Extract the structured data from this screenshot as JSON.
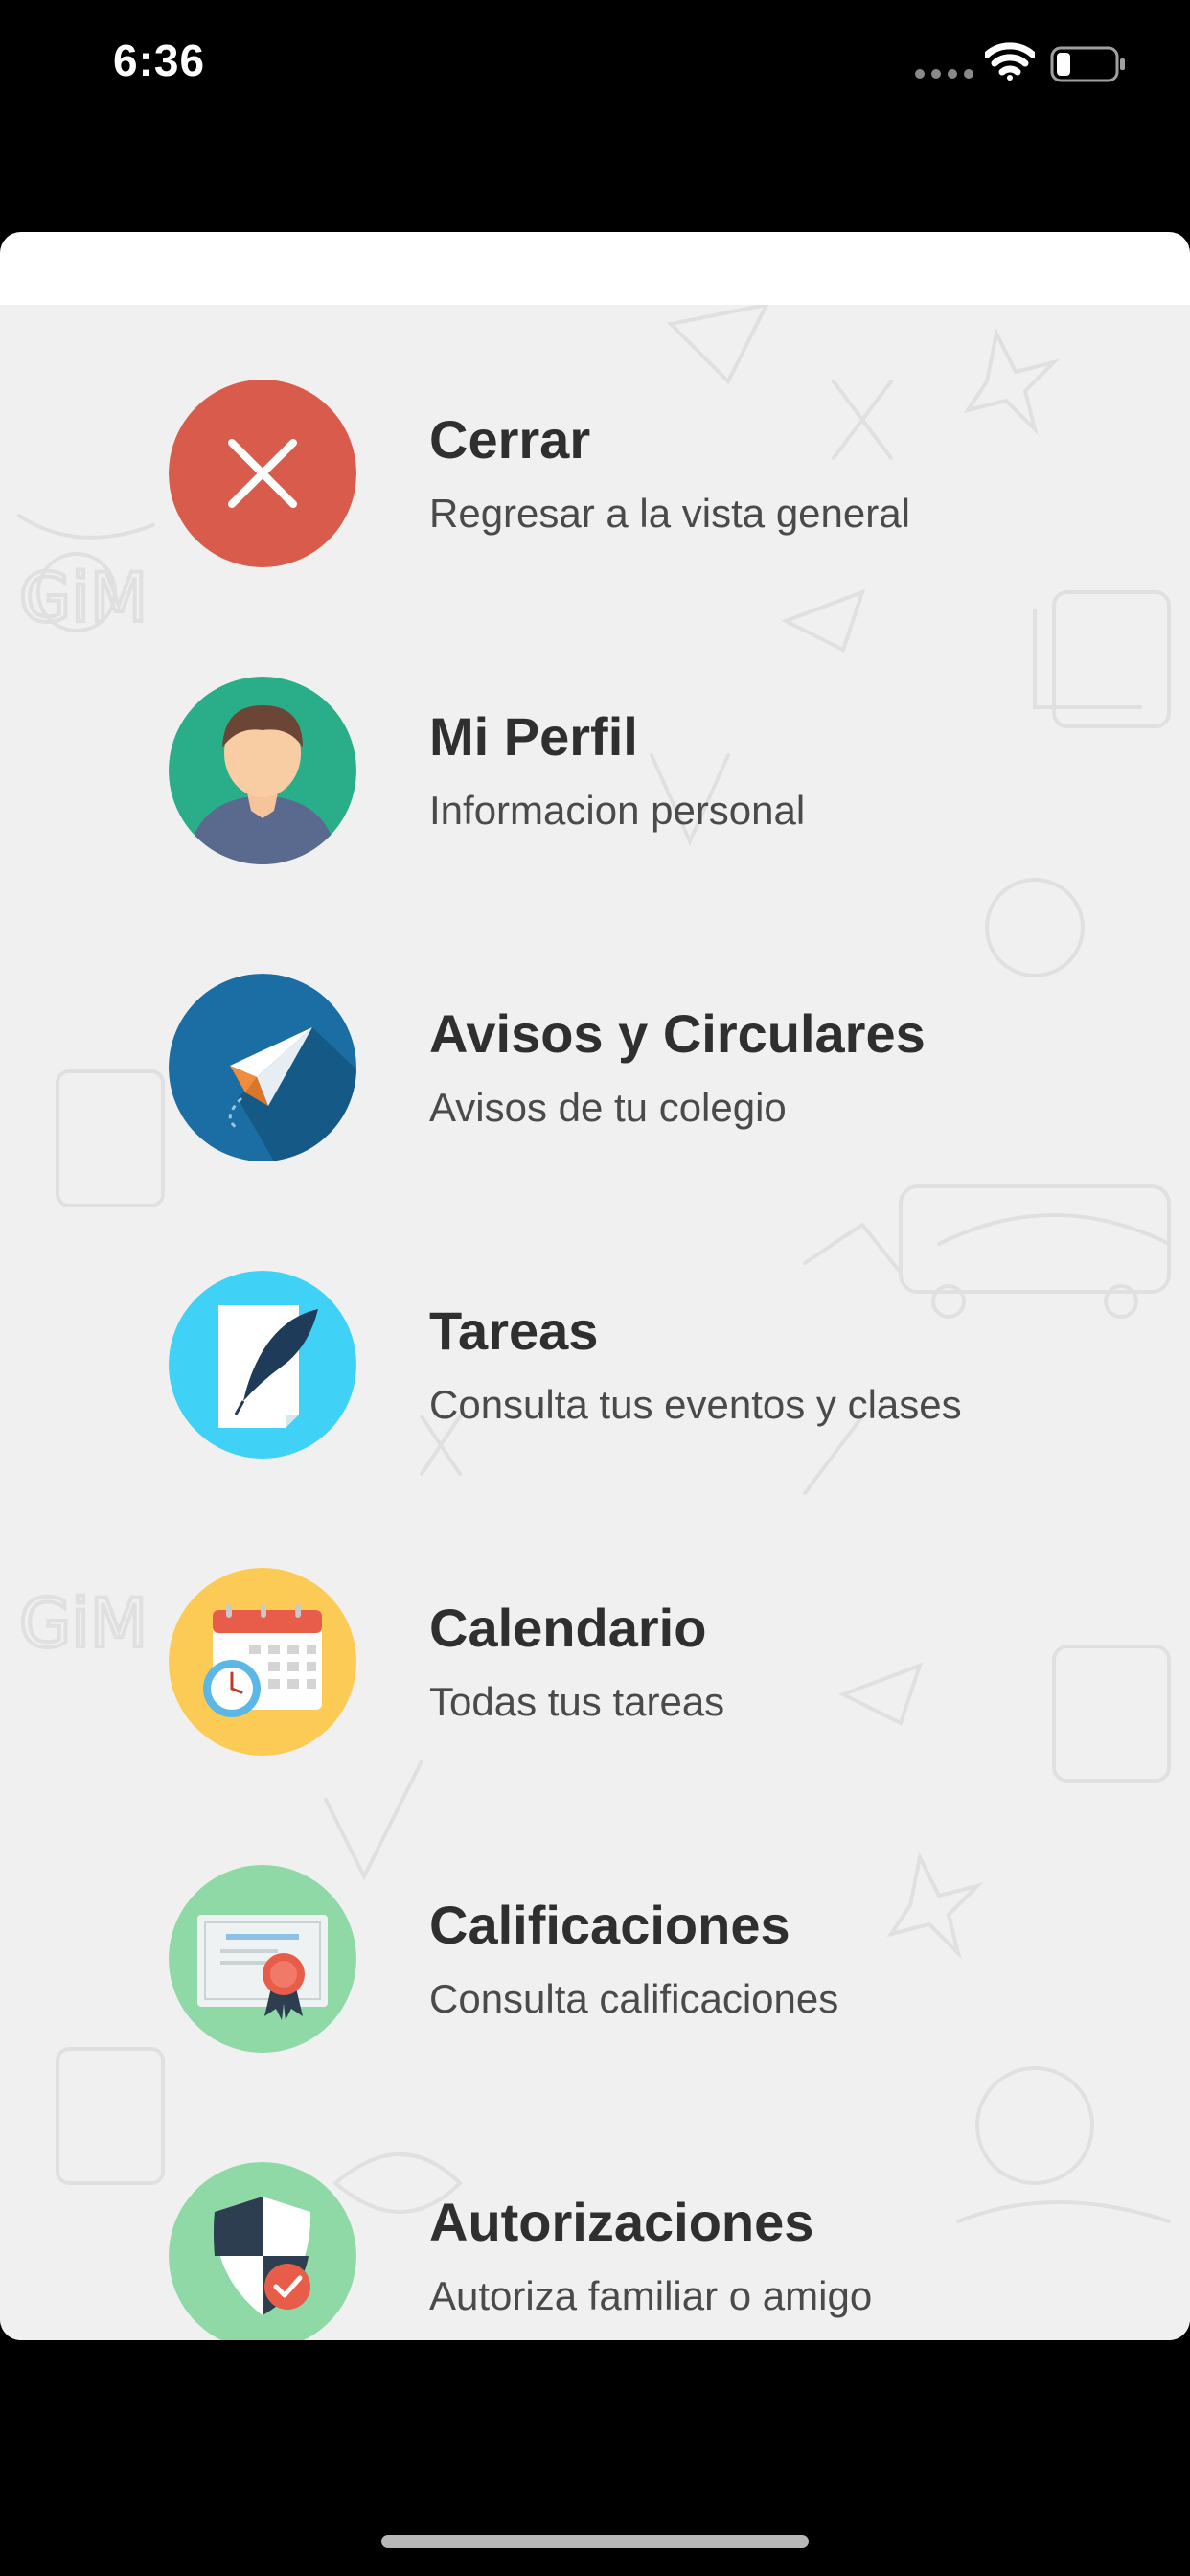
{
  "status_bar": {
    "time": "6:36"
  },
  "menu": {
    "items": [
      {
        "title": "Cerrar",
        "subtitle": "Regresar a la vista general",
        "icon": "close-icon",
        "color": "#d95b4b"
      },
      {
        "title": "Mi Perfil",
        "subtitle": "Informacion personal",
        "icon": "profile-icon",
        "color": "#2aae8a"
      },
      {
        "title": "Avisos y Circulares",
        "subtitle": "Avisos de tu colegio",
        "icon": "paper-plane-icon",
        "color": "#1a6ea3"
      },
      {
        "title": "Tareas",
        "subtitle": "Consulta tus eventos y clases",
        "icon": "document-feather-icon",
        "color": "#3fd2f6"
      },
      {
        "title": "Calendario",
        "subtitle": "Todas tus tareas",
        "icon": "calendar-icon",
        "color": "#fbcb55"
      },
      {
        "title": "Calificaciones",
        "subtitle": "Consulta calificaciones",
        "icon": "certificate-icon",
        "color": "#8ed9a6"
      },
      {
        "title": "Autorizaciones",
        "subtitle": "Autoriza familiar o amigo",
        "icon": "shield-check-icon",
        "color": "#8ed9a6"
      }
    ]
  }
}
